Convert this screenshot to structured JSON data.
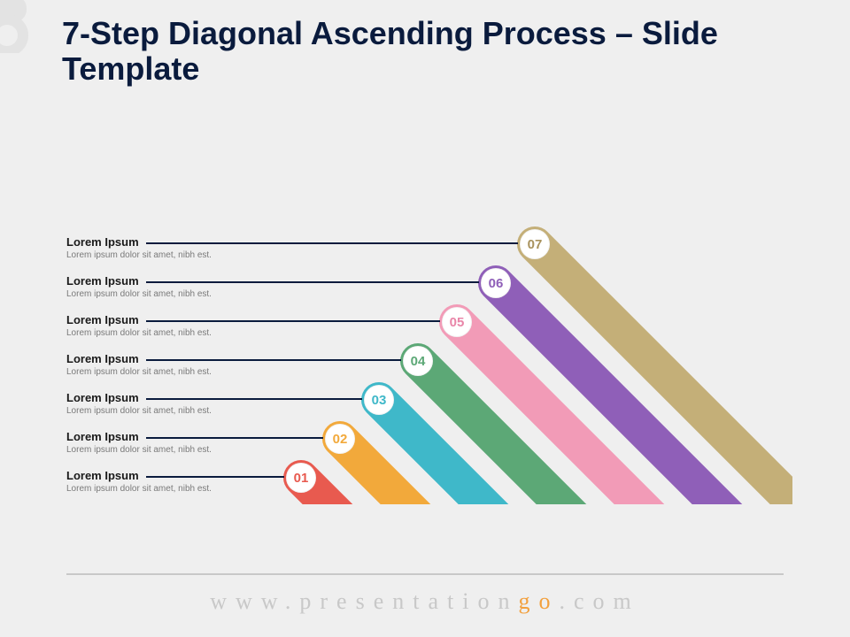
{
  "title": "7-Step Diagonal Ascending Process – Slide Template",
  "footer": {
    "prefix": "www.",
    "mid1": "presentation",
    "accent": "go",
    "suffix": ".com"
  },
  "steps": [
    {
      "num": "01",
      "title": "Lorem Ipsum",
      "desc": "Lorem ipsum dolor sit amet, nibh est.",
      "color": "#e85a4f",
      "text": "#e85a4f"
    },
    {
      "num": "02",
      "title": "Lorem Ipsum",
      "desc": "Lorem ipsum dolor sit amet, nibh est.",
      "color": "#f2a93b",
      "text": "#f2a93b"
    },
    {
      "num": "03",
      "title": "Lorem Ipsum",
      "desc": "Lorem ipsum dolor sit amet, nibh est.",
      "color": "#3fb8c9",
      "text": "#3fb8c9"
    },
    {
      "num": "04",
      "title": "Lorem Ipsum",
      "desc": "Lorem ipsum dolor sit amet, nibh est.",
      "color": "#5ca876",
      "text": "#5ca876"
    },
    {
      "num": "05",
      "title": "Lorem Ipsum",
      "desc": "Lorem ipsum dolor sit amet, nibh est.",
      "color": "#f29bb7",
      "text": "#e985a8"
    },
    {
      "num": "06",
      "title": "Lorem Ipsum",
      "desc": "Lorem ipsum dolor sit amet, nibh est.",
      "color": "#8f5fb8",
      "text": "#8f5fb8"
    },
    {
      "num": "07",
      "title": "Lorem Ipsum",
      "desc": "Lorem ipsum dolor sit amet, nibh est.",
      "color": "#c4af78",
      "text": "#a8925d"
    }
  ]
}
